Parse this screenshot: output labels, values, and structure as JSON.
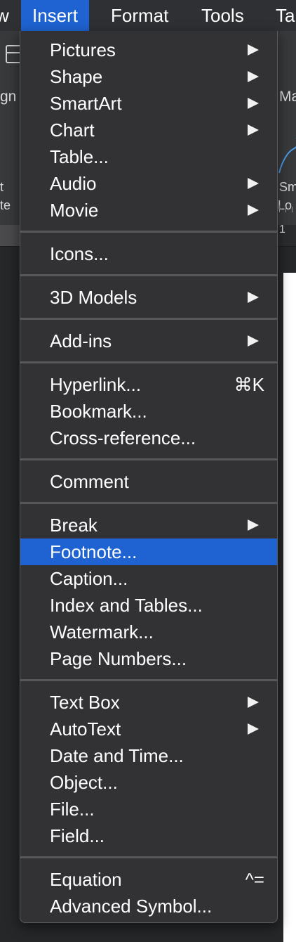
{
  "menubar": {
    "items": [
      {
        "label": "w"
      },
      {
        "label": "Insert"
      },
      {
        "label": "Format"
      },
      {
        "label": "Tools"
      },
      {
        "label": "Ta"
      }
    ]
  },
  "background": {
    "texts": [
      "gn",
      "t",
      "te",
      "Ma",
      "Sm",
      "Lo",
      "1"
    ]
  },
  "insert_menu": {
    "groups": [
      [
        {
          "label": "Pictures",
          "submenu": true
        },
        {
          "label": "Shape",
          "submenu": true
        },
        {
          "label": "SmartArt",
          "submenu": true
        },
        {
          "label": "Chart",
          "submenu": true
        },
        {
          "label": "Table...",
          "submenu": false
        },
        {
          "label": "Audio",
          "submenu": true
        },
        {
          "label": "Movie",
          "submenu": true
        }
      ],
      [
        {
          "label": "Icons...",
          "submenu": false
        }
      ],
      [
        {
          "label": "3D Models",
          "submenu": true
        }
      ],
      [
        {
          "label": "Add-ins",
          "submenu": true
        }
      ],
      [
        {
          "label": "Hyperlink...",
          "submenu": false,
          "shortcut": "⌘K"
        },
        {
          "label": "Bookmark...",
          "submenu": false
        },
        {
          "label": "Cross-reference...",
          "submenu": false
        }
      ],
      [
        {
          "label": "Comment",
          "submenu": false
        }
      ],
      [
        {
          "label": "Break",
          "submenu": true
        },
        {
          "label": "Footnote...",
          "submenu": false,
          "highlighted": true
        },
        {
          "label": "Caption...",
          "submenu": false
        },
        {
          "label": "Index and Tables...",
          "submenu": false
        },
        {
          "label": "Watermark...",
          "submenu": false
        },
        {
          "label": "Page Numbers...",
          "submenu": false
        }
      ],
      [
        {
          "label": "Text Box",
          "submenu": true
        },
        {
          "label": "AutoText",
          "submenu": true
        },
        {
          "label": "Date and Time...",
          "submenu": false
        },
        {
          "label": "Object...",
          "submenu": false
        },
        {
          "label": "File...",
          "submenu": false
        },
        {
          "label": "Field...",
          "submenu": false
        }
      ],
      [
        {
          "label": "Equation",
          "submenu": false,
          "shortcut": "^="
        },
        {
          "label": "Advanced Symbol...",
          "submenu": false
        }
      ]
    ]
  },
  "colors": {
    "highlight": "#1e63d1",
    "menu_background": "#323235",
    "menubar_background": "#2e3034"
  }
}
